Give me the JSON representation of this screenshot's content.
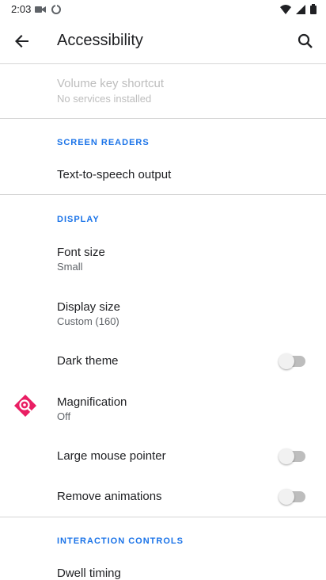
{
  "status": {
    "time": "2:03"
  },
  "app_bar": {
    "title": "Accessibility"
  },
  "volume_shortcut": {
    "title": "Volume key shortcut",
    "subtitle": "No services installed"
  },
  "screen_readers": {
    "header": "SCREEN READERS",
    "tts": "Text-to-speech output"
  },
  "display": {
    "header": "DISPLAY",
    "font_size": {
      "title": "Font size",
      "subtitle": "Small"
    },
    "display_size": {
      "title": "Display size",
      "subtitle": "Custom (160)"
    },
    "dark_theme": {
      "title": "Dark theme",
      "checked": false
    },
    "magnification": {
      "title": "Magnification",
      "subtitle": "Off"
    },
    "large_pointer": {
      "title": "Large mouse pointer",
      "checked": false
    },
    "remove_animations": {
      "title": "Remove animations",
      "checked": false
    }
  },
  "interaction": {
    "header": "INTERACTION CONTROLS",
    "dwell": "Dwell timing"
  },
  "colors": {
    "accent": "#1a73e8",
    "magnification_icon": "#e91e63"
  }
}
